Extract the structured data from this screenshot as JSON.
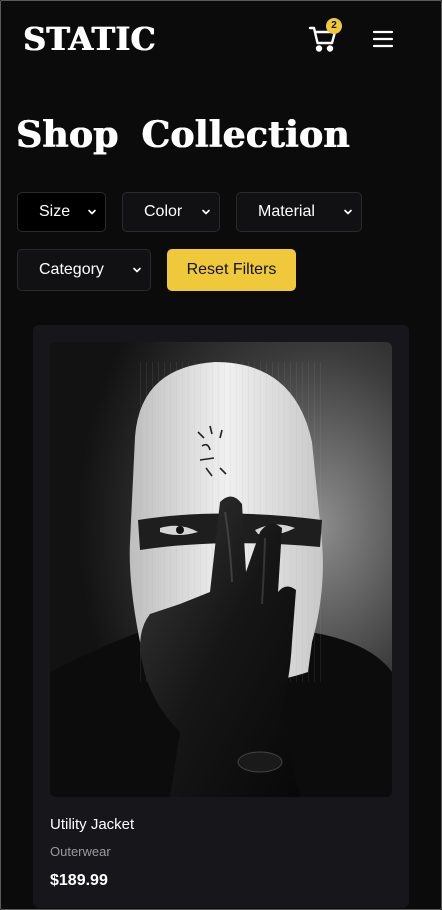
{
  "header": {
    "logo": "STATIC",
    "cart_count": "2",
    "icons": {
      "cart": "shopping-cart-icon",
      "menu": "hamburger-menu-icon"
    }
  },
  "page": {
    "title": "Shop Collection"
  },
  "filters": {
    "size": "Size",
    "color": "Color",
    "material": "Material",
    "category": "Category",
    "reset": "Reset Filters"
  },
  "products": [
    {
      "name": "Utility Jacket",
      "category": "Outerwear",
      "price": "$189.99",
      "image": "black-and-white portrait, knit balaclava and black leather glove"
    }
  ],
  "colors": {
    "background": "#0b0b0c",
    "accent": "#f0c93a",
    "card": "#17171b",
    "muted_text": "#9a9aa0"
  }
}
